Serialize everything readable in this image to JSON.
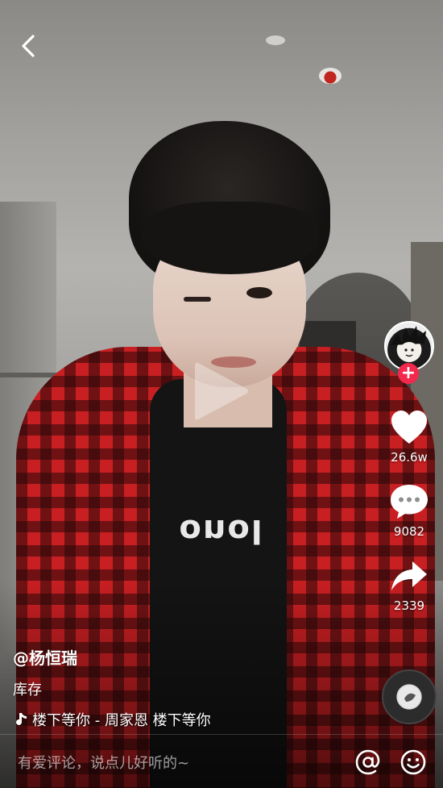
{
  "video": {
    "shirt_print": "onol"
  },
  "creator": {
    "handle": "@杨恒瑞",
    "follow_symbol": "+"
  },
  "caption": "库存",
  "music": {
    "text": "楼下等你 - 周家恩    楼下等你"
  },
  "actions": {
    "likes": "26.6w",
    "comments": "9082",
    "shares": "2339"
  },
  "comment_bar": {
    "placeholder": "有爱评论，说点儿好听的~"
  },
  "icons": {
    "back": "chevron-left-icon",
    "play": "play-icon",
    "like": "heart-icon",
    "comment": "speech-bubble-icon",
    "share": "share-arrow-icon",
    "mention": "at-sign-icon",
    "emoji": "smiley-icon",
    "music": "music-note-icon"
  },
  "colors": {
    "follow": "#f2294d",
    "text": "#ffffff"
  }
}
